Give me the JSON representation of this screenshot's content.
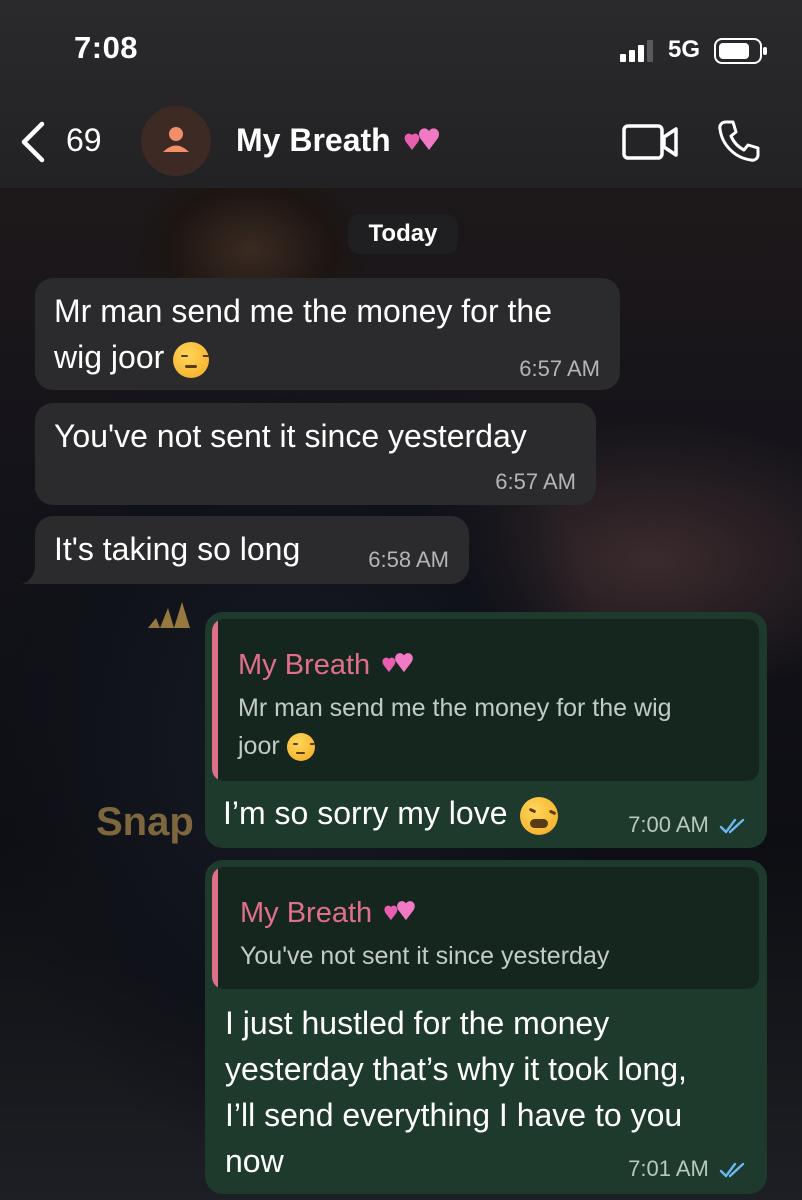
{
  "status_bar": {
    "time": "7:08",
    "network": "5G"
  },
  "header": {
    "back_count": "69",
    "contact_name": "My Breath"
  },
  "date_separator": "Today",
  "wallpaper": {
    "text": "Snap"
  },
  "messages": [
    {
      "direction": "in",
      "lines": [
        "Mr man send me the money for the",
        "wig joor"
      ],
      "time": "6:57 AM"
    },
    {
      "direction": "in",
      "lines": [
        "You've not sent it since yesterday"
      ],
      "time": "6:57 AM"
    },
    {
      "direction": "in",
      "lines": [
        "It's taking so long"
      ],
      "time": "6:58 AM"
    },
    {
      "direction": "out",
      "quote_name": "My Breath",
      "quote_lines": [
        "Mr man send me the money for the wig",
        "joor"
      ],
      "lines": [
        "I’m so sorry my love"
      ],
      "time": "7:00 AM",
      "status": "read"
    },
    {
      "direction": "out",
      "quote_name": "My Breath",
      "quote_lines": [
        "You've not sent it since yesterday"
      ],
      "lines": [
        "I just hustled for the money",
        "yesterday that’s why it took long,",
        "I’ll send everything I have to you",
        "now"
      ],
      "time": "7:01 AM",
      "status": "read"
    }
  ],
  "colors": {
    "incoming_bubble": "#2b2b2d",
    "outgoing_bubble": "#1d3a2d",
    "quote_accent": "#e06f8a",
    "read_ticks": "#6cb7f0"
  },
  "icons": [
    "back-chevron-icon",
    "person-icon",
    "two-hearts-icon",
    "video-camera-icon",
    "phone-icon",
    "signal-icon",
    "battery-icon",
    "double-check-icon",
    "unamused-face-emoji",
    "tired-face-emoji"
  ]
}
